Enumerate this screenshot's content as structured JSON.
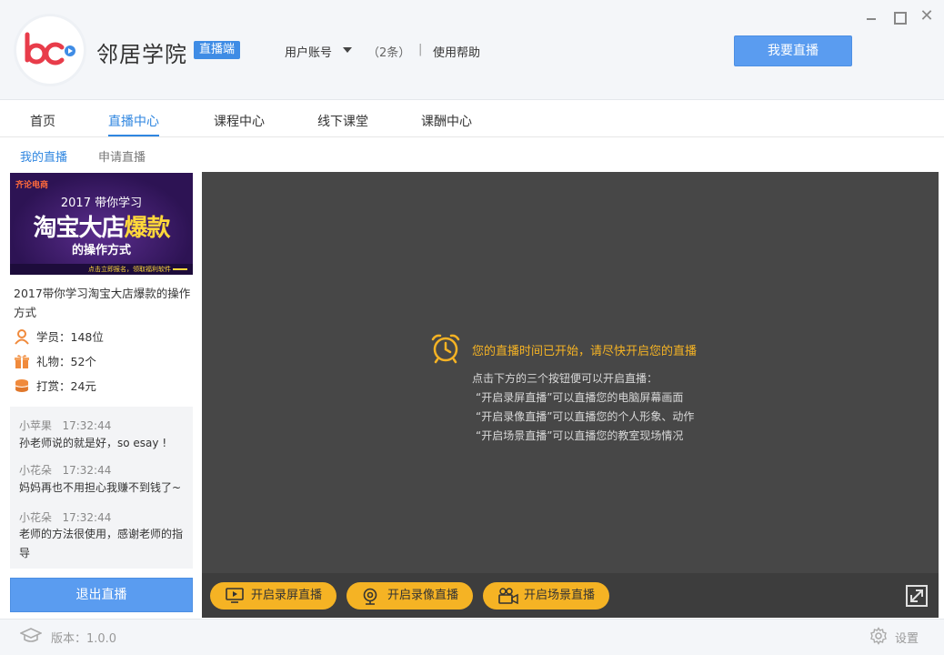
{
  "header": {
    "app_title": "邻居学院",
    "mode_badge": "直播端",
    "account_label": "用户账号",
    "message_count": "（2条）",
    "separator": "|",
    "help_label": "使用帮助",
    "go_live_label": "我要直播",
    "close_glyph": "✕"
  },
  "nav": {
    "tabs": [
      {
        "label": "首页"
      },
      {
        "label": "直播中心",
        "active": true
      },
      {
        "label": "课程中心"
      },
      {
        "label": "线下课堂"
      },
      {
        "label": "课酬中心"
      }
    ]
  },
  "subtabs": [
    {
      "label": "我的直播",
      "active": true
    },
    {
      "label": "申请直播"
    }
  ],
  "course": {
    "cover": {
      "brand_prefix": "齐论",
      "brand_suffix": "电商",
      "subtitle": "2017 带你学习",
      "main_a": "淘宝大店",
      "main_b": "爆款",
      "tagline": "的操作方式",
      "note": "点击立即报名，领取福利软件"
    },
    "title": "2017带你学习淘宝大店爆款的操作方式",
    "stats": [
      {
        "icon": "student-icon",
        "text": "学员：148位"
      },
      {
        "icon": "gift-icon",
        "text": "礼物：52个"
      },
      {
        "icon": "coin-icon",
        "text": "打赏：24元"
      }
    ]
  },
  "chat": [
    {
      "name": "小苹果",
      "time": "17:32:44",
      "message": "孙老师说的就是好，so esay !"
    },
    {
      "name": "小花朵",
      "time": "17:32:44",
      "message": "妈妈再也不用担心我赚不到钱了~"
    },
    {
      "name": "小花朵",
      "time": "17:32:44",
      "message": "老师的方法很使用，感谢老师的指导"
    }
  ],
  "exit_label": "退出直播",
  "stage": {
    "notice_title": "您的直播时间已开始，请尽快开启您的直播",
    "lines": [
      "点击下方的三个按钮便可以开启直播：",
      "“开启录屏直播”可以直播您的电脑屏幕画面",
      "“开启录像直播”可以直播您的个人形象、动作",
      "“开启场景直播”可以直播您的教室现场情况"
    ],
    "buttons": [
      {
        "label": "开启录屏直播",
        "icon": "screen-icon"
      },
      {
        "label": "开启录像直播",
        "icon": "webcam-icon"
      },
      {
        "label": "开启场景直播",
        "icon": "camera-icon"
      }
    ]
  },
  "footer": {
    "version": "版本：1.0.0",
    "settings": "设置"
  },
  "colors": {
    "accent": "#2f86e0",
    "button_blue": "#5a9cf0",
    "live_button": "#f5b324",
    "stage_bg": "#474747"
  }
}
